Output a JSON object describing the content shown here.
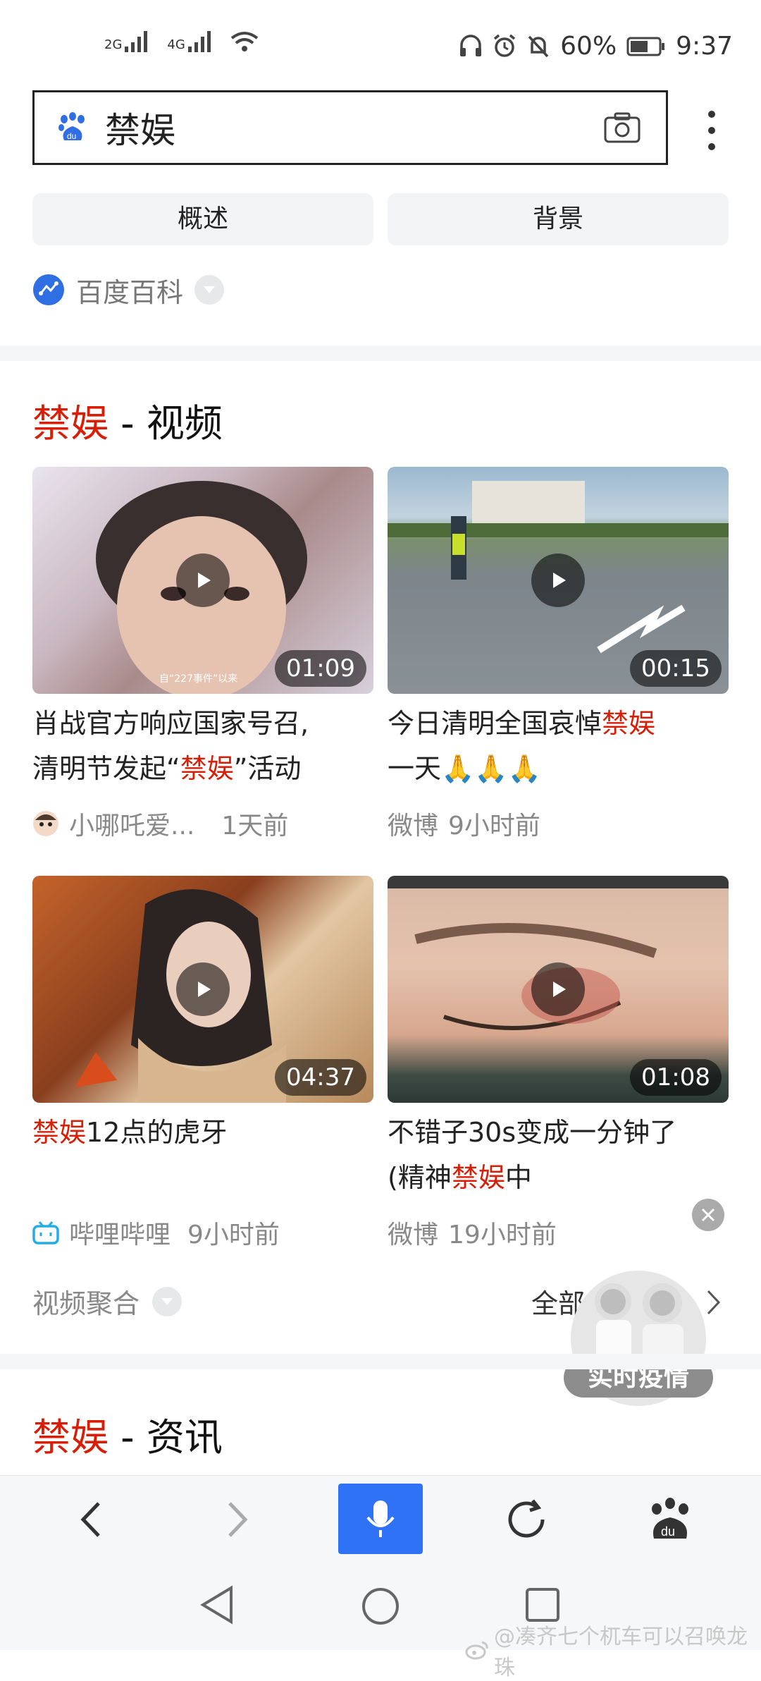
{
  "status": {
    "signal1": "2G",
    "signal2": "4G",
    "battery": "60%",
    "time": "9:37"
  },
  "search": {
    "query": "禁娱"
  },
  "chips": [
    "概述",
    "背景"
  ],
  "baike": {
    "label": "百度百科"
  },
  "video_section": {
    "title_hl": "禁娱",
    "title_rest": " - 视频",
    "cards": [
      {
        "duration": "01:09",
        "title_a": "肖战官方响应国家号召,\n清明节发起“",
        "title_hl": "禁娱",
        "title_b": "”活动",
        "source": "小哪吒爱...",
        "time": "1天前",
        "overlay": "自“227事件”以来"
      },
      {
        "duration": "00:15",
        "title_a": "今日清明全国哀悼",
        "title_hl": "禁娱",
        "title_b": "\n一天🙏🙏🙏",
        "source": "微博",
        "time": "9小时前"
      },
      {
        "duration": "04:37",
        "title_a": "",
        "title_hl": "禁娱",
        "title_b": "12点的虎牙",
        "source": "哔哩哔哩",
        "time": "9小时前"
      },
      {
        "duration": "01:08",
        "title_a": "不错子30s变成一分钟了\n(精神",
        "title_hl": "禁娱",
        "title_b": "中",
        "source": "微博",
        "time": "19小时前"
      }
    ],
    "footer_left": "视频聚合",
    "footer_right": "全部",
    "badge": "实时疫情"
  },
  "news_section": {
    "title_hl": "禁娱",
    "title_rest": " - 资讯"
  },
  "watermark": "@凑齐七个杌车可以召唤龙珠",
  "icons": [
    "baidu-paw-icon",
    "camera-icon",
    "more-icon",
    "back-icon",
    "forward-icon",
    "mic-icon",
    "refresh-icon",
    "baidu-home-icon"
  ]
}
